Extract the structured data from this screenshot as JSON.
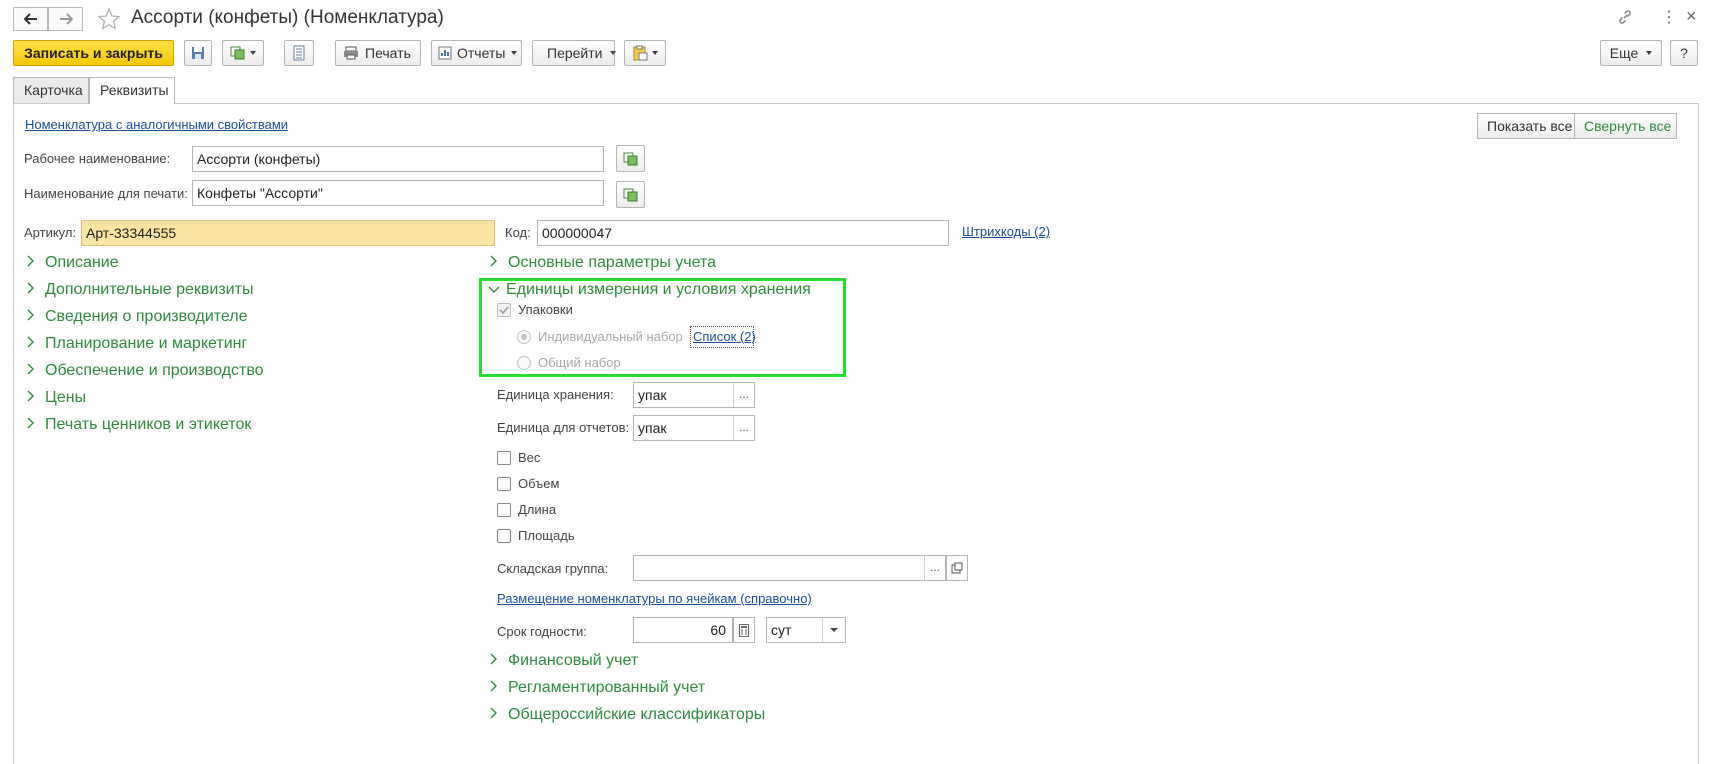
{
  "window": {
    "title": "Ассорти (конфеты) (Номенклатура)"
  },
  "toolbar": {
    "save_close": "Записать и закрыть",
    "print": "Печать",
    "reports": "Отчеты",
    "goto": "Перейти",
    "more": "Еще",
    "help": "?"
  },
  "tabs": [
    {
      "label": "Карточка",
      "active": false
    },
    {
      "label": "Реквизиты",
      "active": true
    }
  ],
  "header": {
    "similar_link": "Номенклатура с аналогичными свойствами",
    "show_all": "Показать все",
    "collapse_all": "Свернуть все"
  },
  "fields": {
    "work_name_label": "Рабочее наименование:",
    "work_name_value": "Ассорти (конфеты)",
    "print_name_label": "Наименование для печати:",
    "print_name_value": "Конфеты \"Ассорти\"",
    "article_label": "Артикул:",
    "article_value": "Арт-33344555",
    "code_label": "Код:",
    "code_value": "000000047",
    "barcodes_link": "Штрихкоды (2)"
  },
  "left_groups": [
    "Описание",
    "Дополнительные реквизиты",
    "Сведения о производителе",
    "Планирование и маркетинг",
    "Обеспечение и производство",
    "Цены",
    "Печать ценников и этикеток"
  ],
  "right": {
    "basic_params": "Основные параметры учета",
    "units_group": "Единицы измерения и условия хранения",
    "packages_label": "Упаковки",
    "individual_set": "Индивидуальный набор",
    "list_link": "Список (2)",
    "common_set": "Общий набор",
    "storage_unit_label": "Единица хранения:",
    "storage_unit_value": "упак",
    "report_unit_label": "Единица для отчетов:",
    "report_unit_value": "упак",
    "weight": "Вес",
    "volume": "Объем",
    "length": "Длина",
    "area": "Площадь",
    "warehouse_group_label": "Складская группа:",
    "warehouse_group_value": "",
    "placement_link": "Размещение номенклатуры по ячейкам (справочно)",
    "shelf_life_label": "Срок годности:",
    "shelf_life_value": "60",
    "shelf_life_unit": "сут",
    "financial": "Финансовый учет",
    "regulated": "Регламентированный учет",
    "classifiers": "Общероссийские классификаторы"
  },
  "colors": {
    "accent_green": "#2e8b3e",
    "highlight": "#22e02b",
    "link": "#1a4fa0",
    "primary_button": "#f5c800"
  }
}
